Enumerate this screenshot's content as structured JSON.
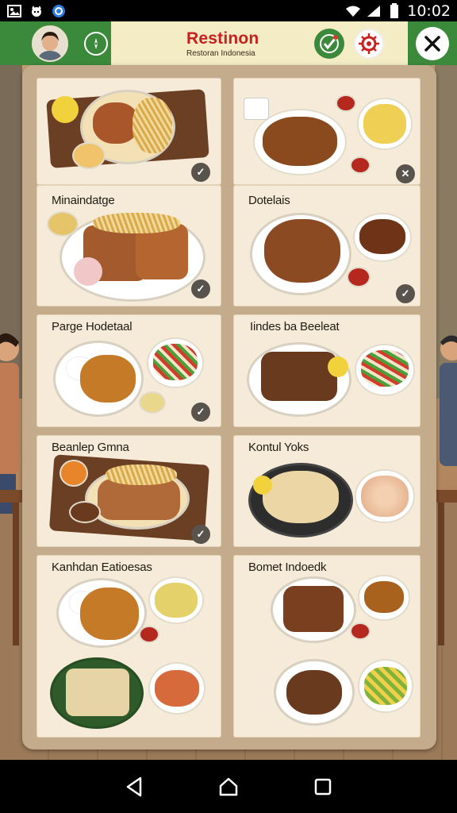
{
  "status_bar": {
    "time": "10:02",
    "left_icons": [
      "gallery-icon",
      "cat-icon",
      "shield-icon"
    ],
    "right_icons": [
      "wifi-icon",
      "signal-icon",
      "battery-icon"
    ]
  },
  "header": {
    "title": "Restinon",
    "subtitle": "Restoran Indonesia",
    "icons": [
      "avatar",
      "compass-icon",
      "check-leaf-icon",
      "gear-icon",
      "close-icon"
    ]
  },
  "cards": [
    {
      "label": "",
      "dishes": [
        "fried-chicken-platter"
      ],
      "selected": true
    },
    {
      "label": "",
      "dishes": [
        "curry-soup",
        "yellow-rice"
      ],
      "selected": false
    },
    {
      "label": "Minaindatge",
      "dishes": [
        "grilled-meat-plate"
      ],
      "selected": true
    },
    {
      "label": "Dotelais",
      "dishes": [
        "roast-pork",
        "beef-stew"
      ],
      "selected": true
    },
    {
      "label": "Parge Hodetaal",
      "dishes": [
        "chicken-curry-rice",
        "salad"
      ],
      "selected": true
    },
    {
      "label": "Iindes ba Beeleat",
      "dishes": [
        "grilled-steak",
        "vegetable-salad"
      ],
      "selected": false
    },
    {
      "label": "Beanlep Gmna",
      "dishes": [
        "grilled-fish-platter"
      ],
      "selected": true
    },
    {
      "label": "Kontul Yoks",
      "dishes": [
        "chicken-noodles",
        "bean-salad"
      ],
      "selected": false
    },
    {
      "label": "Kanhdan Eatioesas",
      "dishes": [
        "chicken-curry",
        "tofu",
        "vegetables"
      ],
      "selected": false
    },
    {
      "label": "Bomet Indoedk",
      "dishes": [
        "meat-stew",
        "soup",
        "vegetables"
      ],
      "selected": false
    }
  ],
  "check_glyph": "✓",
  "x_glyph": "✕",
  "navigation": {
    "buttons": [
      "back-button",
      "home-button",
      "recents-button"
    ]
  },
  "colors": {
    "header_green": "#3b8a3c",
    "title_red": "#c8201f",
    "card_bg": "#f5ebd8",
    "board_bg": "#c4ab8b"
  }
}
